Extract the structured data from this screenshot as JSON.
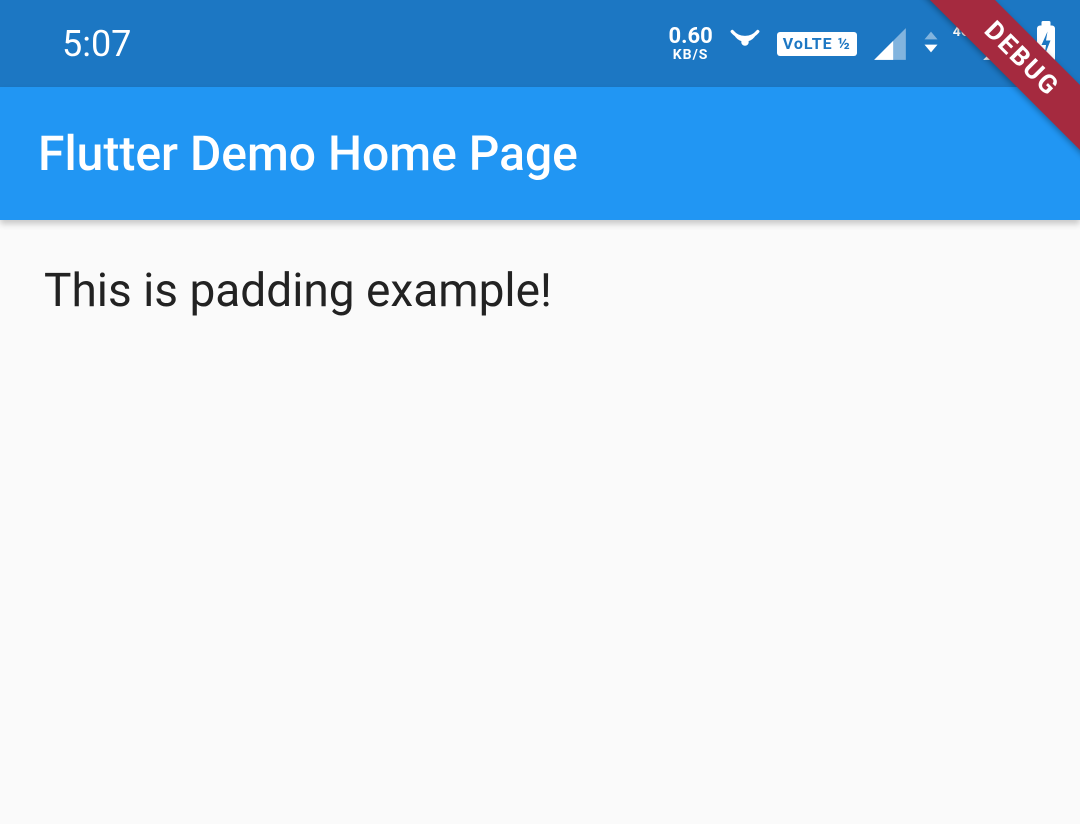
{
  "status_bar": {
    "time": "5:07",
    "speed": {
      "value": "0.60",
      "unit": "KB/S"
    },
    "volte_label": "VoLTE ½",
    "network_label": "4G+"
  },
  "app_bar": {
    "title": "Flutter Demo Home Page"
  },
  "body": {
    "text": "This is padding example!"
  },
  "debug_banner": "DEBUG"
}
